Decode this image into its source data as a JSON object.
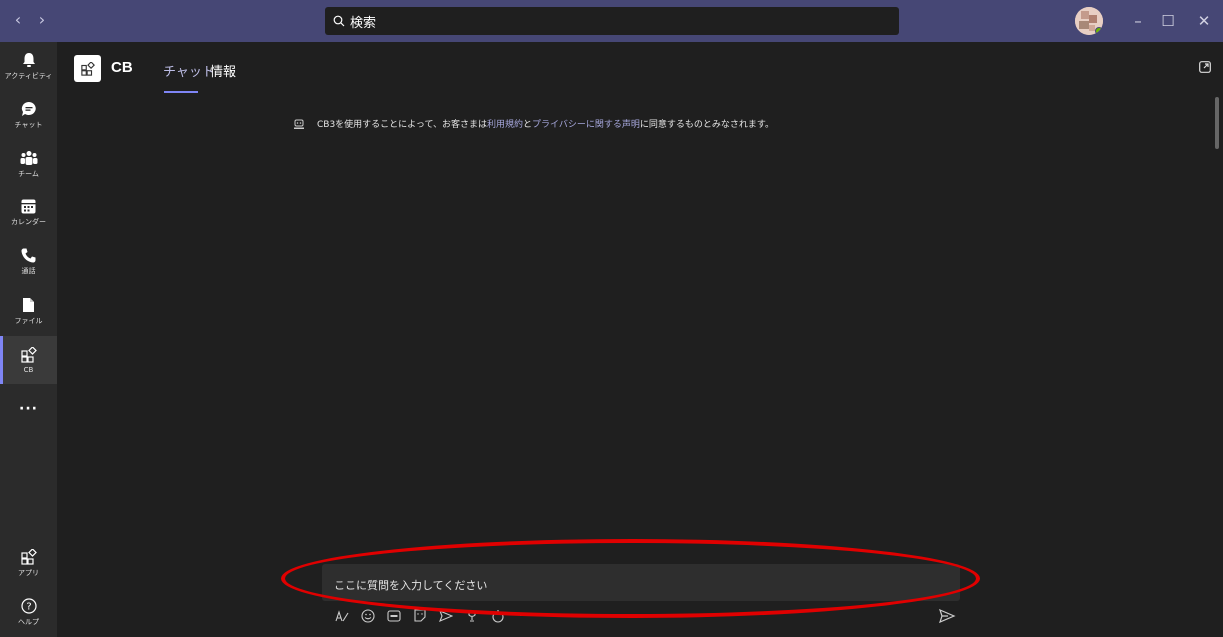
{
  "titlebar": {
    "search_placeholder": "検索",
    "back_glyph": "‹",
    "forward_glyph": "›",
    "minimize_glyph": "–",
    "maximize_glyph": "☐",
    "close_glyph": "✕"
  },
  "rail": {
    "items": [
      {
        "label": "アクティビティ",
        "icon": "bell-icon"
      },
      {
        "label": "チャット",
        "icon": "chat-icon"
      },
      {
        "label": "チーム",
        "icon": "teams-icon"
      },
      {
        "label": "カレンダー",
        "icon": "calendar-icon"
      },
      {
        "label": "通話",
        "icon": "phone-icon"
      },
      {
        "label": "ファイル",
        "icon": "file-icon"
      },
      {
        "label": "CB",
        "icon": "app-icon",
        "active": true
      },
      {
        "label": "",
        "icon": "more-icon"
      }
    ],
    "bottom_items": [
      {
        "label": "アプリ",
        "icon": "apps-icon"
      },
      {
        "label": "ヘルプ",
        "icon": "help-icon"
      }
    ],
    "more_glyph": "···"
  },
  "header": {
    "app_name": "CB",
    "tabs": [
      {
        "label": "チャット",
        "active": true
      },
      {
        "label": "情報",
        "active": false
      }
    ]
  },
  "notice": {
    "prefix": "CB3を使用することによって、お客さまは",
    "link1": "利用規約",
    "middle": "と",
    "link2": "プライバシーに関する声明",
    "suffix": "に同意するものとみなされます。"
  },
  "composer": {
    "placeholder": "ここに質問を入力してください"
  },
  "colors": {
    "titlebar": "#464775",
    "accent": "#7f85f5",
    "link": "#a6a7dc",
    "highlight_oval": "#e00000"
  }
}
